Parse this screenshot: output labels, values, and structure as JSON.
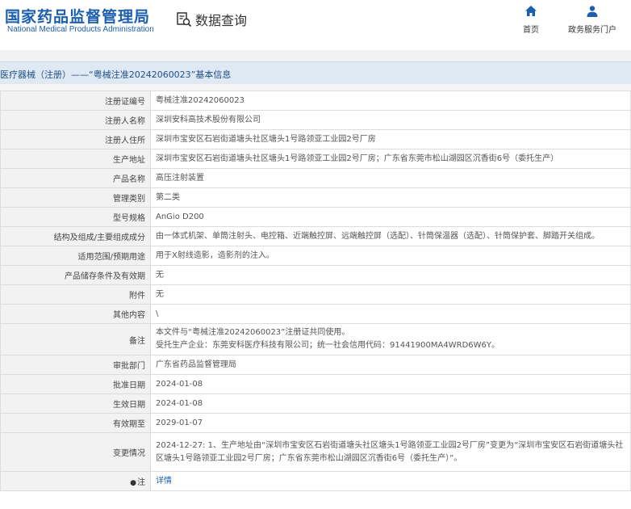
{
  "header": {
    "logo_cn": "国家药品监督管理局",
    "logo_en": "National Medical Products Administration",
    "search_label": "数据查询",
    "nav": [
      {
        "label": "首页",
        "icon": "home-icon"
      },
      {
        "label": "政务服务门户",
        "icon": "user-icon"
      }
    ],
    "brand_color": "#1b5fae"
  },
  "title_bar": {
    "text": "医疗器械（注册）——“粤械注准20242060023”基本信息"
  },
  "rows": [
    {
      "label": "注册证编号",
      "value": "粤械注准20242060023"
    },
    {
      "label": "注册人名称",
      "value": "深圳安科高技术股份有限公司"
    },
    {
      "label": "注册人住所",
      "value": "深圳市宝安区石岩街道塘头社区塘头1号路领亚工业园2号厂房"
    },
    {
      "label": "生产地址",
      "value": "深圳市宝安区石岩街道塘头社区塘头1号路领亚工业园2号厂房；广东省东莞市松山湖园区沉香街6号（委托生产）"
    },
    {
      "label": "产品名称",
      "value": "高压注射装置"
    },
    {
      "label": "管理类别",
      "value": "第二类"
    },
    {
      "label": "型号规格",
      "value": "AnGio D200"
    },
    {
      "label": "结构及组成/主要组成成分",
      "value": "由一体式机架、单筒注射头、电控箱、近端触控屏、远端触控屏（选配）、针筒保温器（选配）、针筒保护套、脚踏开关组成。"
    },
    {
      "label": "适用范围/预期用途",
      "value": "用于X射线造影，造影剂的注入。"
    },
    {
      "label": "产品储存条件及有效期",
      "value": "无"
    },
    {
      "label": "附件",
      "value": "无"
    },
    {
      "label": "其他内容",
      "value": "\\"
    },
    {
      "label": "备注",
      "value_line1": "本文件与“粤械注准20242060023”注册证共同使用。",
      "value_line2": "受托生产企业：东莞安科医疗科技有限公司；统一社会信用代码：91441900MA4WRD6W6Y。"
    },
    {
      "label": "审批部门",
      "value": "广东省药品监督管理局"
    },
    {
      "label": "批准日期",
      "value": "2024-01-08"
    },
    {
      "label": "生效日期",
      "value": "2024-01-08"
    },
    {
      "label": "有效期至",
      "value": "2029-01-07"
    },
    {
      "label": "变更情况",
      "value_line1": "2024-12-27: 1、生产地址由“深圳市宝安区石岩街道塘头社区塘头1号路领亚工业园2号厂房”变更为“深圳市宝安区石岩街道塘头社",
      "value_line2": "区塘头1号路领亚工业园2号厂房；广东省东莞市松山湖园区沉香街6号（委托生产）”。"
    },
    {
      "label": "注",
      "pin": "●",
      "value": "详情"
    }
  ]
}
